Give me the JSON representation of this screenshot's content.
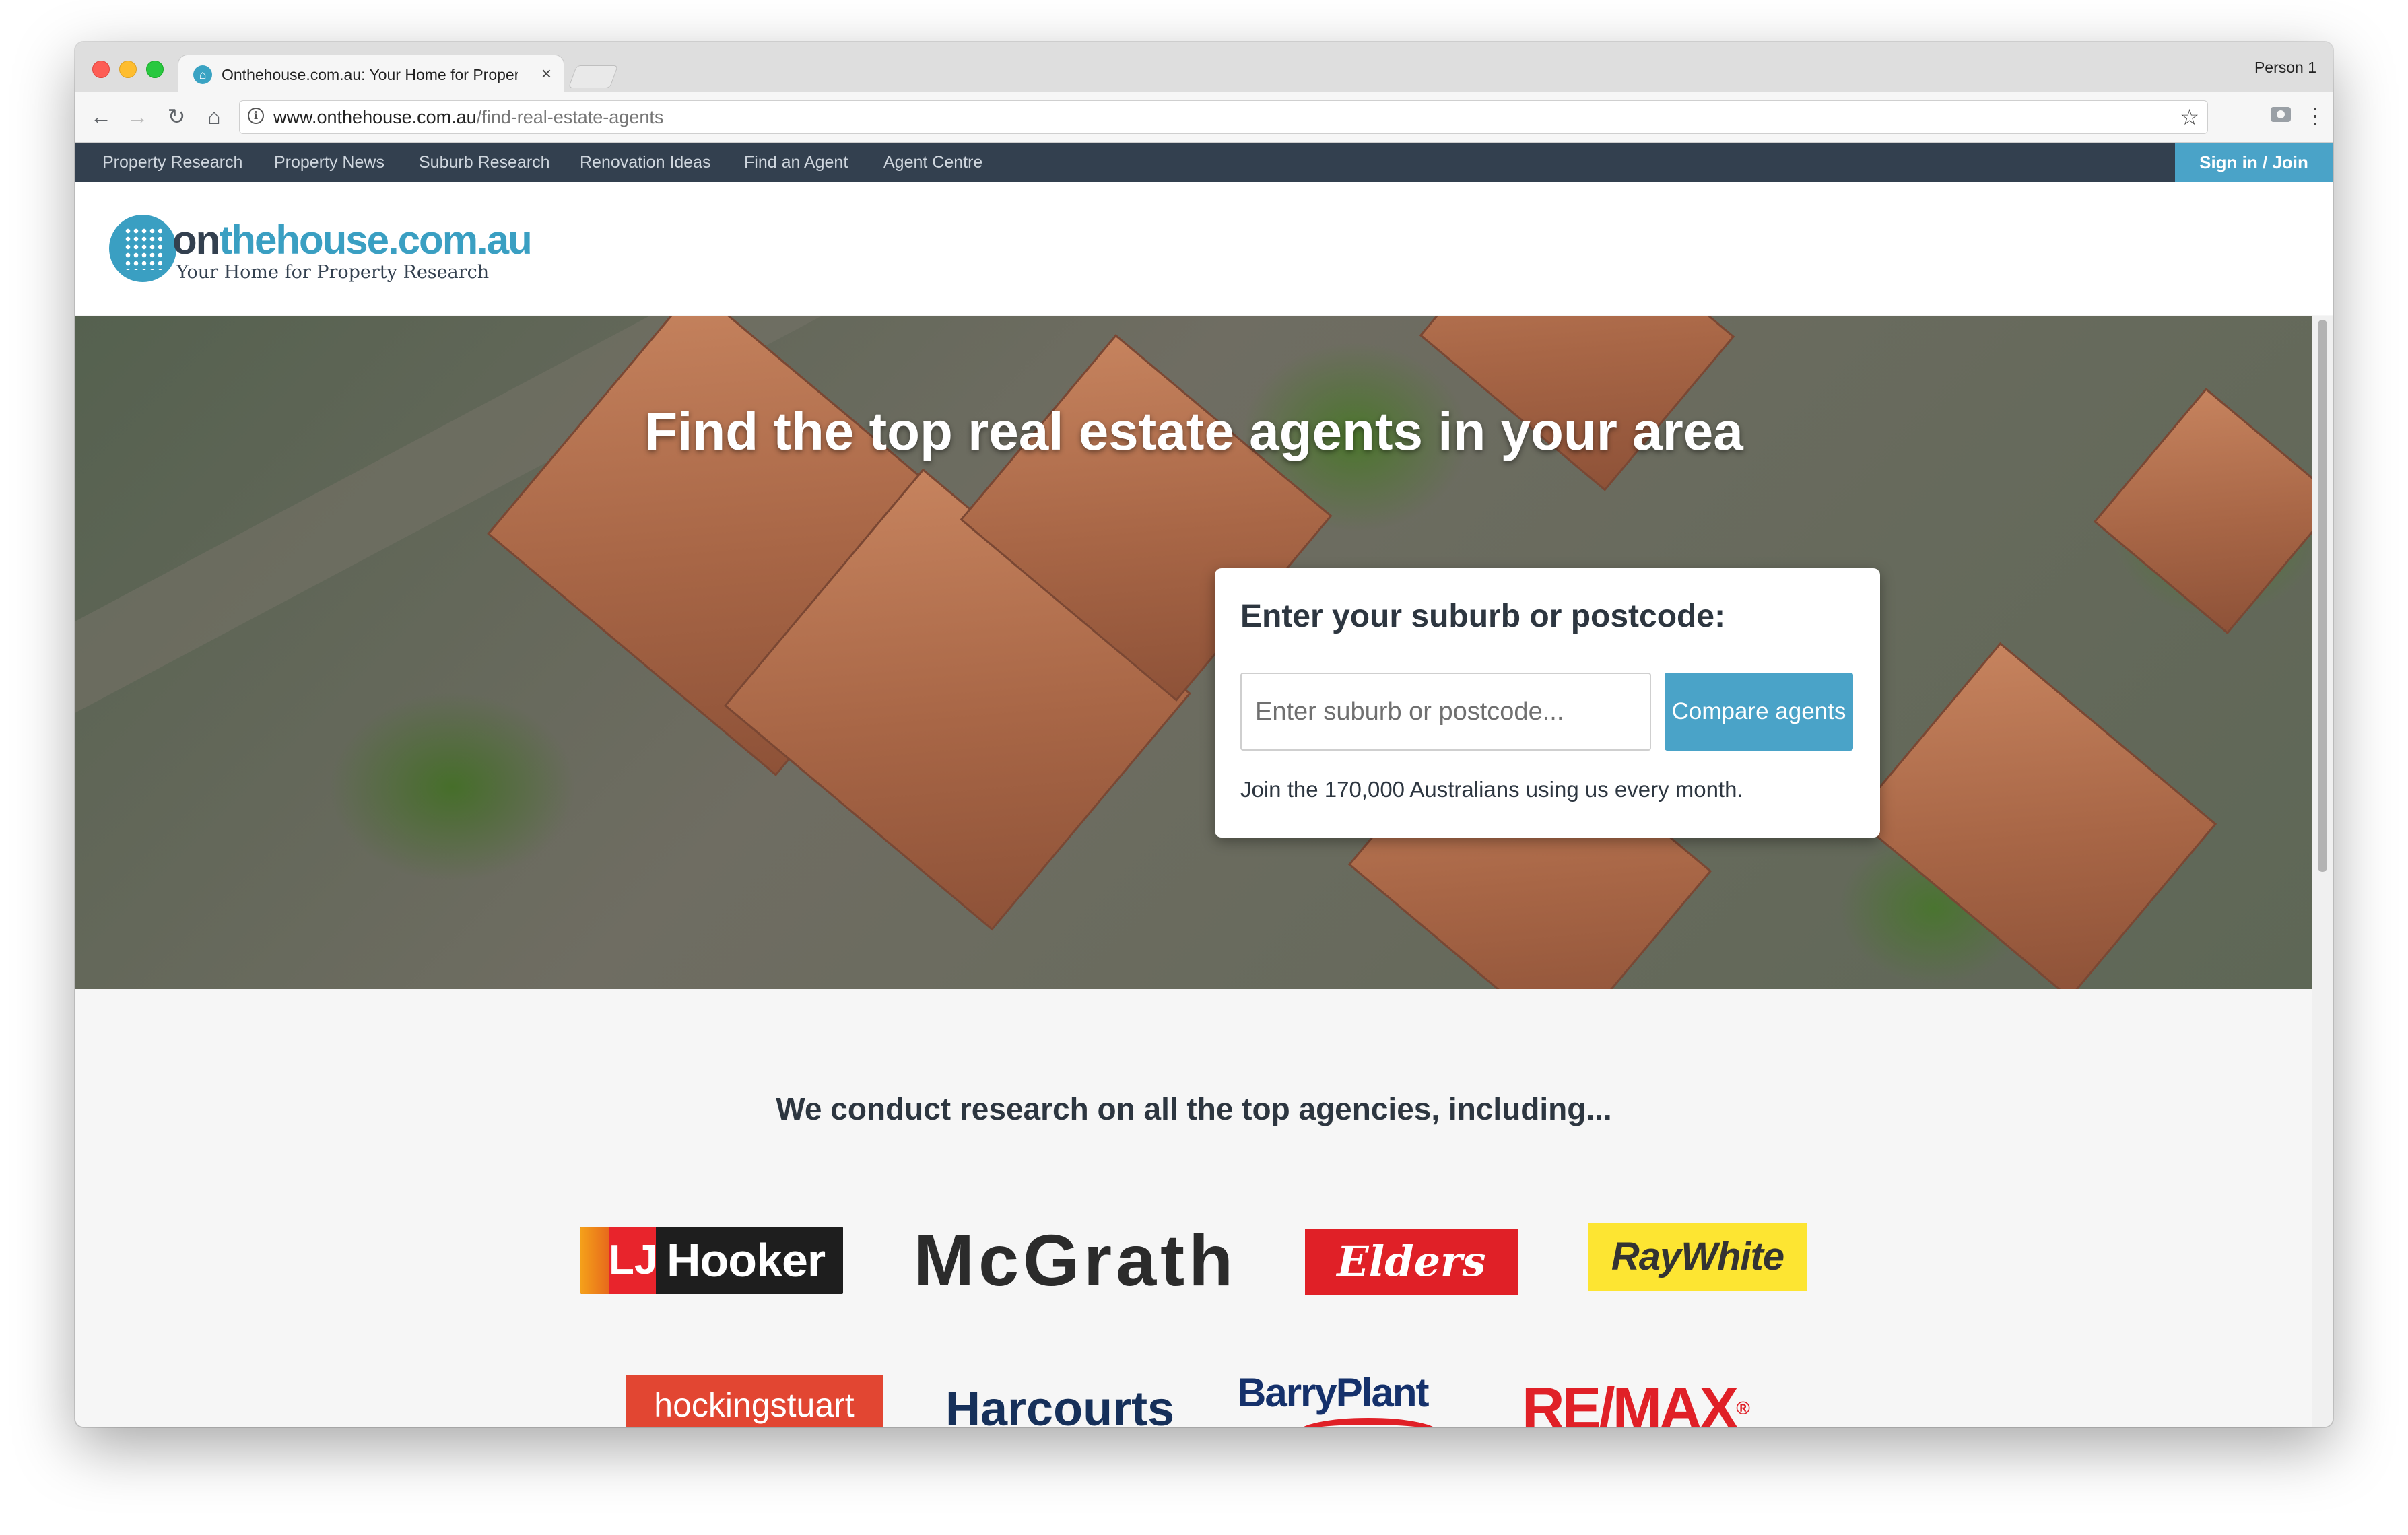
{
  "browser": {
    "tab_title": "Onthehouse.com.au: Your Home for Property Research",
    "tab_close": "×",
    "profile": "Person 1",
    "url_host": "www.onthehouse.com.au",
    "url_path": "/find-real-estate-agents",
    "icons": [
      "back-icon",
      "forward-icon",
      "reload-icon",
      "home-icon",
      "info-icon",
      "star-icon",
      "camera-icon",
      "menu-dots-icon"
    ]
  },
  "topnav": {
    "items": [
      "Property Research",
      "Property News",
      "Suburb Research",
      "Renovation Ideas",
      "Find an Agent",
      "Agent Centre"
    ],
    "signin": "Sign in / Join"
  },
  "logo": {
    "on": "on",
    "rest": "thehouse.com.au",
    "tagline": "Your Home for Property Research"
  },
  "hero": {
    "title": "Find the top real estate agents in your area",
    "card_heading": "Enter your suburb or postcode:",
    "input_placeholder": "Enter suburb or postcode...",
    "button_label": "Compare agents",
    "note": "Join the 170,000 Australians using us every month."
  },
  "agencies": {
    "heading": "We conduct research on all the top agencies, including...",
    "lj_box": "LJ",
    "lj_text": "Hooker",
    "mcgrath": "McGrath",
    "elders": "Elders",
    "raywhite": "RayWhite",
    "hockingstuart": "hockingstuart",
    "harcourts": "Harcourts",
    "barryplant": "BarryPlant",
    "remax": "RE/MAX",
    "remax_reg": "®"
  },
  "colors": {
    "nav_bg": "#33404f",
    "accent": "#4aa3c8",
    "heading_text": "#2d3640"
  }
}
